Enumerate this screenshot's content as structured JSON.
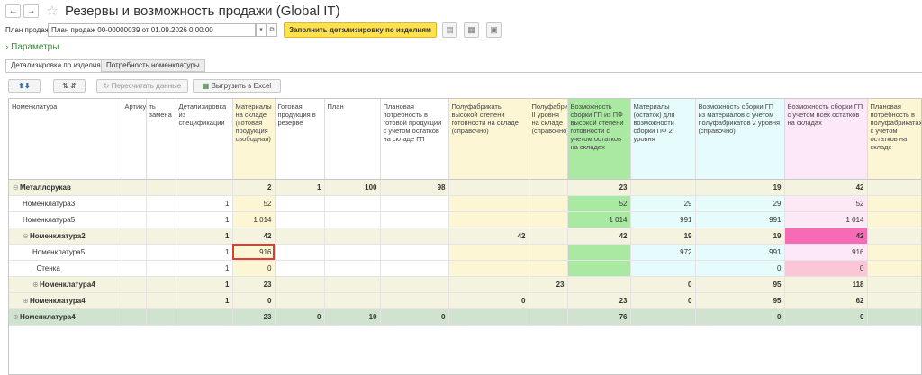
{
  "window": {
    "title": "Резервы и возможность продажи (Global IT)"
  },
  "plan": {
    "label": "План продаж:",
    "value": "План продаж 00-00000039 от 01.09.2026 0:00:00"
  },
  "buttons": {
    "fill": "Заполнить детализировку по изделиям",
    "recalc": "Пересчитать данные",
    "export": "Выгрузить в Excel"
  },
  "params": {
    "label": "Параметры"
  },
  "tabs": [
    "Детализировка по изделиям",
    "Потребность номенклатуры"
  ],
  "columns": [
    "Номенклатура",
    "Артикул",
    "ть замена",
    "Детализировка из спецификации",
    "Материалы на складе (Готовая продукция свободная)",
    "Готовая продукция в резерве",
    "План",
    "Плановая потребность в готовой продукции с учетом остатков на складе ГП",
    "Полуфабрикаты высокой степени готовности на складе (справочно)",
    "Полуфабрикаты II уровня на складе (справочно)",
    "Возможность сборки ГП из ПФ высокой степени готовности с учетом остатков на складах",
    "Материалы (остаток) для возможности сборки ПФ 2 уровня",
    "Возможность сборки ГП из материалов с учетом полуфабрикатов 2 уровня (справочно)",
    "Возможность сборки ГП с учетом всех остатков на складах",
    "Плановая потребность в полуфабрикатах с учетом остатков на складе"
  ],
  "rows": [
    {
      "name": "Металлорукав",
      "style": "grp",
      "toggle": "⊖",
      "indent": 0,
      "c": [
        "",
        "",
        "",
        "2",
        "1",
        "100",
        "98",
        "",
        "",
        "23",
        "",
        "19",
        "42",
        ""
      ]
    },
    {
      "name": "Номенклатура3",
      "style": "",
      "toggle": "",
      "indent": 1,
      "c": [
        "",
        "",
        "1",
        "52",
        "",
        "",
        "",
        "",
        "",
        "52",
        "29",
        "29",
        "52",
        ""
      ]
    },
    {
      "name": "Номенклатура5",
      "style": "",
      "toggle": "",
      "indent": 1,
      "c": [
        "",
        "",
        "1",
        "1 014",
        "",
        "",
        "",
        "",
        "",
        "1 014",
        "991",
        "991",
        "1 014",
        ""
      ]
    },
    {
      "name": "Номенклатура2",
      "style": "grp",
      "toggle": "⊖",
      "indent": 1,
      "c": [
        "",
        "",
        "1",
        "42",
        "",
        "",
        "",
        "42",
        "",
        "42",
        "19",
        "19",
        "42",
        ""
      ],
      "pink": "strong"
    },
    {
      "name": "Номенклатура5",
      "style": "",
      "toggle": "",
      "indent": 2,
      "c": [
        "",
        "",
        "1",
        "916",
        "",
        "",
        "",
        "",
        "",
        "",
        "972",
        "991",
        "916",
        ""
      ],
      "highlight": true
    },
    {
      "name": "_Стенка",
      "style": "",
      "toggle": "",
      "indent": 2,
      "c": [
        "",
        "",
        "1",
        "0",
        "",
        "",
        "",
        "",
        "",
        "",
        "",
        "0",
        "0",
        ""
      ],
      "pink": "light"
    },
    {
      "name": "Номенклатура4",
      "style": "grp",
      "toggle": "⊕",
      "indent": 2,
      "c": [
        "",
        "",
        "1",
        "23",
        "",
        "",
        "",
        "",
        "23",
        "",
        "0",
        "95",
        "118",
        ""
      ]
    },
    {
      "name": "Номенклатура4",
      "style": "grp",
      "toggle": "⊕",
      "indent": 1,
      "c": [
        "",
        "",
        "1",
        "0",
        "",
        "",
        "",
        "0",
        "",
        "23",
        "0",
        "95",
        "62",
        ""
      ]
    },
    {
      "name": "Номенклатура4",
      "style": "top",
      "toggle": "⊕",
      "indent": 0,
      "c": [
        "",
        "",
        "",
        "23",
        "0",
        "10",
        "0",
        "",
        "",
        "76",
        "",
        "0",
        "0",
        ""
      ]
    }
  ],
  "colors": {
    "yellow": "#fdf6d5",
    "green": "#a9e9a1",
    "cyan": "#e6fbfb",
    "pink": "#fde8f7",
    "accent": "#fde24f"
  }
}
